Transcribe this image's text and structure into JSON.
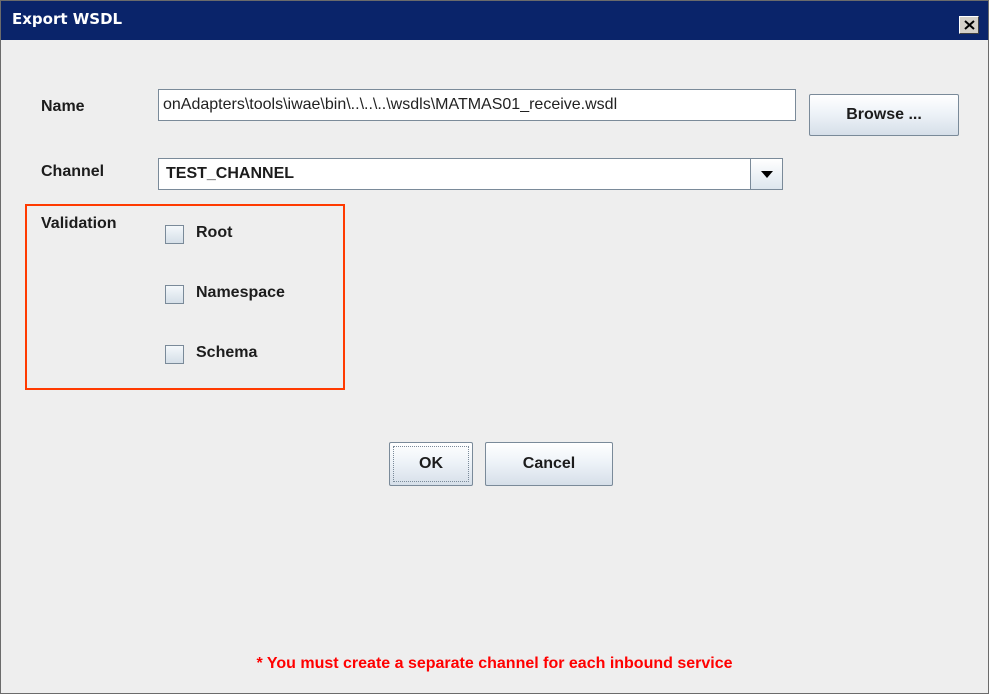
{
  "window": {
    "title": "Export WSDL",
    "close_glyph": "✕"
  },
  "form": {
    "name_label": "Name",
    "name_value": "onAdapters\\tools\\iwae\\bin\\..\\..\\..\\wsdls\\MATMAS01_receive.wsdl",
    "browse_label": "Browse ...",
    "channel_label": "Channel",
    "channel_value": "TEST_CHANNEL",
    "validation_label": "Validation",
    "validation_options": [
      {
        "label": "Root",
        "checked": false
      },
      {
        "label": "Namespace",
        "checked": false
      },
      {
        "label": "Schema",
        "checked": false
      }
    ]
  },
  "buttons": {
    "ok_label": "OK",
    "cancel_label": "Cancel"
  },
  "footnote": "* You must create a separate channel for each inbound service",
  "colors": {
    "titlebar": "#0a246a",
    "highlight_border": "#ff3a00",
    "footnote_text": "#ff0000"
  },
  "icons": {
    "close": "close-icon",
    "dropdown": "chevron-down-icon",
    "checkbox": "checkbox-unchecked-icon"
  }
}
